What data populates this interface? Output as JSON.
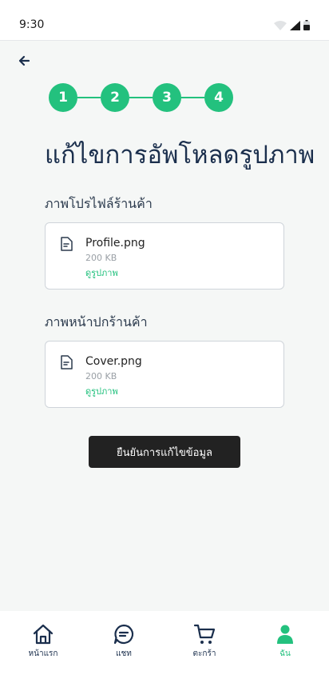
{
  "status_bar": {
    "time": "9:30"
  },
  "stepper": {
    "steps": [
      "1",
      "2",
      "3",
      "4"
    ]
  },
  "page": {
    "title": "แก้ไขการอัพโหลดรูปภาพ"
  },
  "sections": [
    {
      "label": "ภาพโปรไฟล์ร้านค้า",
      "file_name": "Profile.png",
      "file_size": "200 KB",
      "view_label": "ดูรูปภาพ"
    },
    {
      "label": "ภาพหน้าปกร้านค้า",
      "file_name": "Cover.png",
      "file_size": "200 KB",
      "view_label": "ดูรูปภาพ"
    }
  ],
  "confirm_button": {
    "label": "ยืนยันการแก้ไขข้อมูล"
  },
  "bottom_nav": {
    "items": [
      {
        "label": "หน้าแรก",
        "icon": "home-icon"
      },
      {
        "label": "แชท",
        "icon": "chat-icon"
      },
      {
        "label": "ตะกร้า",
        "icon": "cart-icon"
      },
      {
        "label": "ฉัน",
        "icon": "person-icon",
        "active": true
      }
    ]
  },
  "colors": {
    "accent": "#23c17e",
    "title": "#1b2f4d",
    "button": "#222222",
    "background": "#f5f7f6"
  }
}
